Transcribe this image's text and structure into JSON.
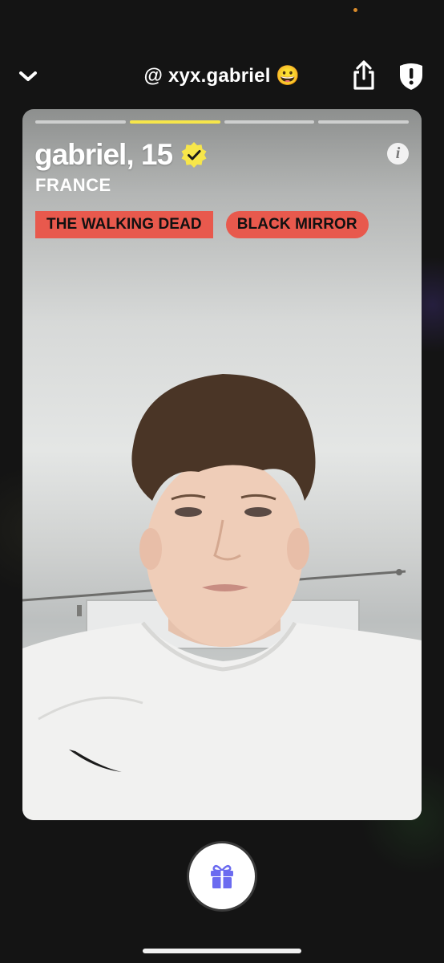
{
  "header": {
    "username": "@ xyx.gabriel 😀"
  },
  "profile": {
    "name_age": "gabriel, 15",
    "country": "FRANCE",
    "interests": [
      "THE WALKING DEAD",
      "BLACK MIRROR"
    ],
    "info_glyph": "i"
  },
  "story_progress": {
    "segments": 4,
    "active_index": 1
  },
  "icons": {
    "back": "chevron-down-icon",
    "share": "share-icon",
    "report": "shield-exclamation-icon",
    "verified": "verified-badge-icon",
    "info": "info-icon",
    "gift": "gift-icon"
  },
  "colors": {
    "accent_yellow": "#f7e64a",
    "tag_red": "#e8594d",
    "gift_purple": "#6b6bf0",
    "status_dot": "#d98b2b"
  }
}
